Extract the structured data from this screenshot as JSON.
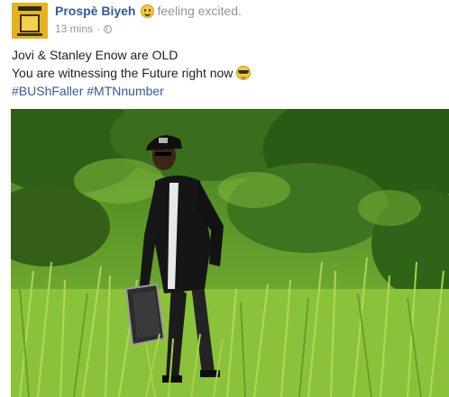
{
  "post": {
    "author": "Prospè Biyeh",
    "activity": "feeling excited.",
    "timestamp": "13 mins",
    "separator": "·",
    "privacy_icon": "globe-icon",
    "feeling_icon": "smiling-face-icon",
    "text_lines": [
      "Jovi & Stanley Enow are OLD",
      "You are witnessing the Future right now"
    ],
    "inline_emoji": "sunglasses-face-icon",
    "hashtags": [
      "#BUShFaller",
      "#MTNnumber"
    ],
    "photo_icon": "photo-man-in-grass"
  },
  "colors": {
    "link": "#365899",
    "secondary_text": "#90949c",
    "body_text": "#1d2129",
    "avatar_bg": "#e5b320"
  }
}
